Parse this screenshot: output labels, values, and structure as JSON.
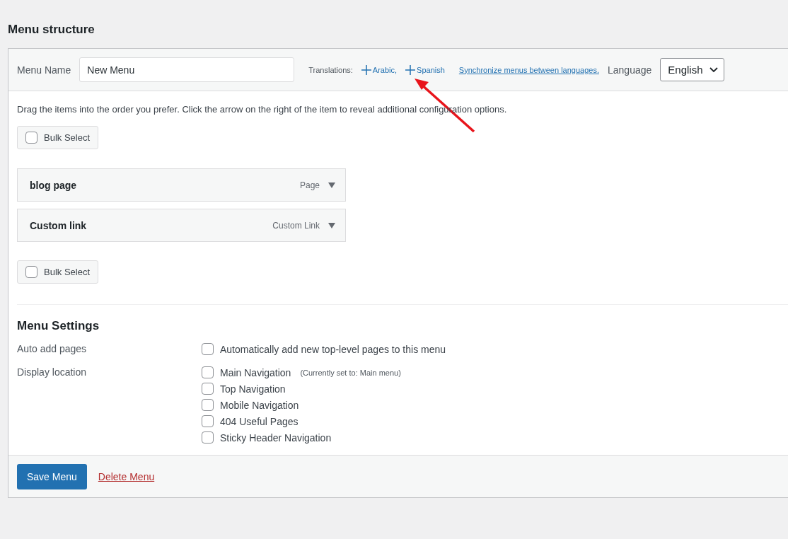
{
  "title": "Menu structure",
  "header": {
    "menu_name_label": "Menu Name",
    "menu_name_value": "New Menu",
    "translations_label": "Translations:",
    "translations": [
      {
        "label": "Arabic,"
      },
      {
        "label": "Spanish"
      }
    ],
    "sync_link": "Synchronize menus between languages.",
    "language_label": "Language",
    "language_value": "English"
  },
  "instructions": "Drag the items into the order you prefer. Click the arrow on the right of the item to reveal additional configuration options.",
  "bulk_select_top": {
    "label": "Bulk Select",
    "checked": false
  },
  "menu_items": [
    {
      "title": "blog page",
      "type": "Page"
    },
    {
      "title": "Custom link",
      "type": "Custom Link"
    }
  ],
  "bulk_select_bottom": {
    "label": "Bulk Select",
    "checked": false
  },
  "settings": {
    "heading": "Menu Settings",
    "auto_add_label": "Auto add pages",
    "auto_add": [
      {
        "label": "Automatically add new top-level pages to this menu",
        "checked": false
      }
    ],
    "display_location_label": "Display location",
    "locations": [
      {
        "label": "Main Navigation",
        "note": "(Currently set to: Main menu)",
        "checked": false
      },
      {
        "label": "Top Navigation",
        "checked": false
      },
      {
        "label": "Mobile Navigation",
        "checked": false
      },
      {
        "label": "404 Useful Pages",
        "checked": false
      },
      {
        "label": "Sticky Header Navigation",
        "checked": false
      }
    ]
  },
  "footer": {
    "save": "Save Menu",
    "delete": "Delete Menu"
  }
}
